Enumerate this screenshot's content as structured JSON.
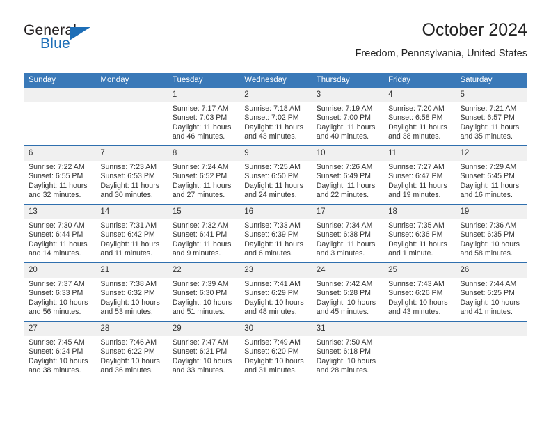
{
  "brand": {
    "name_top": "General",
    "name_bottom": "Blue",
    "accent_color": "#1d6eb7"
  },
  "header": {
    "title": "October 2024",
    "subtitle": "Freedom, Pennsylvania, United States"
  },
  "calendar": {
    "header_bg": "#3a79b8",
    "daynum_bg": "#f0f0f0",
    "row_divider_color": "#2f6fae",
    "weekday_headers": [
      "Sunday",
      "Monday",
      "Tuesday",
      "Wednesday",
      "Thursday",
      "Friday",
      "Saturday"
    ],
    "weeks": [
      [
        {
          "day": "",
          "lines": []
        },
        {
          "day": "",
          "lines": []
        },
        {
          "day": "1",
          "lines": [
            "Sunrise: 7:17 AM",
            "Sunset: 7:03 PM",
            "Daylight: 11 hours",
            "and 46 minutes."
          ]
        },
        {
          "day": "2",
          "lines": [
            "Sunrise: 7:18 AM",
            "Sunset: 7:02 PM",
            "Daylight: 11 hours",
            "and 43 minutes."
          ]
        },
        {
          "day": "3",
          "lines": [
            "Sunrise: 7:19 AM",
            "Sunset: 7:00 PM",
            "Daylight: 11 hours",
            "and 40 minutes."
          ]
        },
        {
          "day": "4",
          "lines": [
            "Sunrise: 7:20 AM",
            "Sunset: 6:58 PM",
            "Daylight: 11 hours",
            "and 38 minutes."
          ]
        },
        {
          "day": "5",
          "lines": [
            "Sunrise: 7:21 AM",
            "Sunset: 6:57 PM",
            "Daylight: 11 hours",
            "and 35 minutes."
          ]
        }
      ],
      [
        {
          "day": "6",
          "lines": [
            "Sunrise: 7:22 AM",
            "Sunset: 6:55 PM",
            "Daylight: 11 hours",
            "and 32 minutes."
          ]
        },
        {
          "day": "7",
          "lines": [
            "Sunrise: 7:23 AM",
            "Sunset: 6:53 PM",
            "Daylight: 11 hours",
            "and 30 minutes."
          ]
        },
        {
          "day": "8",
          "lines": [
            "Sunrise: 7:24 AM",
            "Sunset: 6:52 PM",
            "Daylight: 11 hours",
            "and 27 minutes."
          ]
        },
        {
          "day": "9",
          "lines": [
            "Sunrise: 7:25 AM",
            "Sunset: 6:50 PM",
            "Daylight: 11 hours",
            "and 24 minutes."
          ]
        },
        {
          "day": "10",
          "lines": [
            "Sunrise: 7:26 AM",
            "Sunset: 6:49 PM",
            "Daylight: 11 hours",
            "and 22 minutes."
          ]
        },
        {
          "day": "11",
          "lines": [
            "Sunrise: 7:27 AM",
            "Sunset: 6:47 PM",
            "Daylight: 11 hours",
            "and 19 minutes."
          ]
        },
        {
          "day": "12",
          "lines": [
            "Sunrise: 7:29 AM",
            "Sunset: 6:45 PM",
            "Daylight: 11 hours",
            "and 16 minutes."
          ]
        }
      ],
      [
        {
          "day": "13",
          "lines": [
            "Sunrise: 7:30 AM",
            "Sunset: 6:44 PM",
            "Daylight: 11 hours",
            "and 14 minutes."
          ]
        },
        {
          "day": "14",
          "lines": [
            "Sunrise: 7:31 AM",
            "Sunset: 6:42 PM",
            "Daylight: 11 hours",
            "and 11 minutes."
          ]
        },
        {
          "day": "15",
          "lines": [
            "Sunrise: 7:32 AM",
            "Sunset: 6:41 PM",
            "Daylight: 11 hours",
            "and 9 minutes."
          ]
        },
        {
          "day": "16",
          "lines": [
            "Sunrise: 7:33 AM",
            "Sunset: 6:39 PM",
            "Daylight: 11 hours",
            "and 6 minutes."
          ]
        },
        {
          "day": "17",
          "lines": [
            "Sunrise: 7:34 AM",
            "Sunset: 6:38 PM",
            "Daylight: 11 hours",
            "and 3 minutes."
          ]
        },
        {
          "day": "18",
          "lines": [
            "Sunrise: 7:35 AM",
            "Sunset: 6:36 PM",
            "Daylight: 11 hours",
            "and 1 minute."
          ]
        },
        {
          "day": "19",
          "lines": [
            "Sunrise: 7:36 AM",
            "Sunset: 6:35 PM",
            "Daylight: 10 hours",
            "and 58 minutes."
          ]
        }
      ],
      [
        {
          "day": "20",
          "lines": [
            "Sunrise: 7:37 AM",
            "Sunset: 6:33 PM",
            "Daylight: 10 hours",
            "and 56 minutes."
          ]
        },
        {
          "day": "21",
          "lines": [
            "Sunrise: 7:38 AM",
            "Sunset: 6:32 PM",
            "Daylight: 10 hours",
            "and 53 minutes."
          ]
        },
        {
          "day": "22",
          "lines": [
            "Sunrise: 7:39 AM",
            "Sunset: 6:30 PM",
            "Daylight: 10 hours",
            "and 51 minutes."
          ]
        },
        {
          "day": "23",
          "lines": [
            "Sunrise: 7:41 AM",
            "Sunset: 6:29 PM",
            "Daylight: 10 hours",
            "and 48 minutes."
          ]
        },
        {
          "day": "24",
          "lines": [
            "Sunrise: 7:42 AM",
            "Sunset: 6:28 PM",
            "Daylight: 10 hours",
            "and 45 minutes."
          ]
        },
        {
          "day": "25",
          "lines": [
            "Sunrise: 7:43 AM",
            "Sunset: 6:26 PM",
            "Daylight: 10 hours",
            "and 43 minutes."
          ]
        },
        {
          "day": "26",
          "lines": [
            "Sunrise: 7:44 AM",
            "Sunset: 6:25 PM",
            "Daylight: 10 hours",
            "and 41 minutes."
          ]
        }
      ],
      [
        {
          "day": "27",
          "lines": [
            "Sunrise: 7:45 AM",
            "Sunset: 6:24 PM",
            "Daylight: 10 hours",
            "and 38 minutes."
          ]
        },
        {
          "day": "28",
          "lines": [
            "Sunrise: 7:46 AM",
            "Sunset: 6:22 PM",
            "Daylight: 10 hours",
            "and 36 minutes."
          ]
        },
        {
          "day": "29",
          "lines": [
            "Sunrise: 7:47 AM",
            "Sunset: 6:21 PM",
            "Daylight: 10 hours",
            "and 33 minutes."
          ]
        },
        {
          "day": "30",
          "lines": [
            "Sunrise: 7:49 AM",
            "Sunset: 6:20 PM",
            "Daylight: 10 hours",
            "and 31 minutes."
          ]
        },
        {
          "day": "31",
          "lines": [
            "Sunrise: 7:50 AM",
            "Sunset: 6:18 PM",
            "Daylight: 10 hours",
            "and 28 minutes."
          ]
        },
        {
          "day": "",
          "lines": []
        },
        {
          "day": "",
          "lines": []
        }
      ]
    ]
  }
}
